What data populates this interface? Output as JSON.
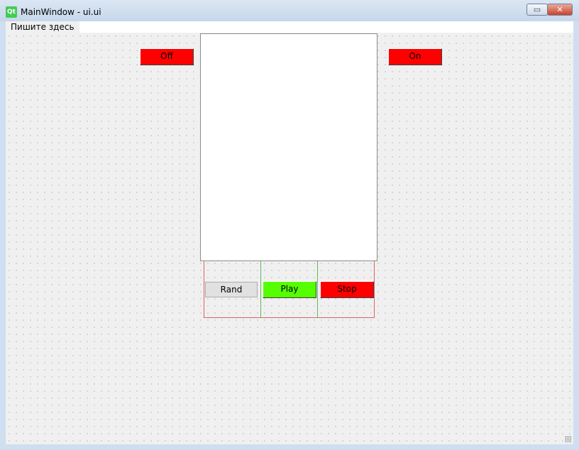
{
  "window": {
    "title": "MainWindow - ui.ui",
    "logo_text": "Qt",
    "minimize_glyph": "▭",
    "close_glyph": "✕"
  },
  "menubar": {
    "items": [
      {
        "label": "Пишите здесь"
      }
    ]
  },
  "buttons": {
    "off": {
      "label": "Off",
      "color": "#ff0000"
    },
    "on": {
      "label": "On",
      "color": "#ff0000"
    },
    "rand": {
      "label": "Rand",
      "color": "#e1e1e1"
    },
    "play": {
      "label": "Play",
      "color": "#55ff00"
    },
    "stop": {
      "label": "Stop",
      "color": "#ff0000"
    }
  },
  "icons": {
    "app": "qt-logo-icon",
    "minimize": "minimize-icon",
    "close": "close-icon",
    "resize": "resize-grip-icon"
  }
}
